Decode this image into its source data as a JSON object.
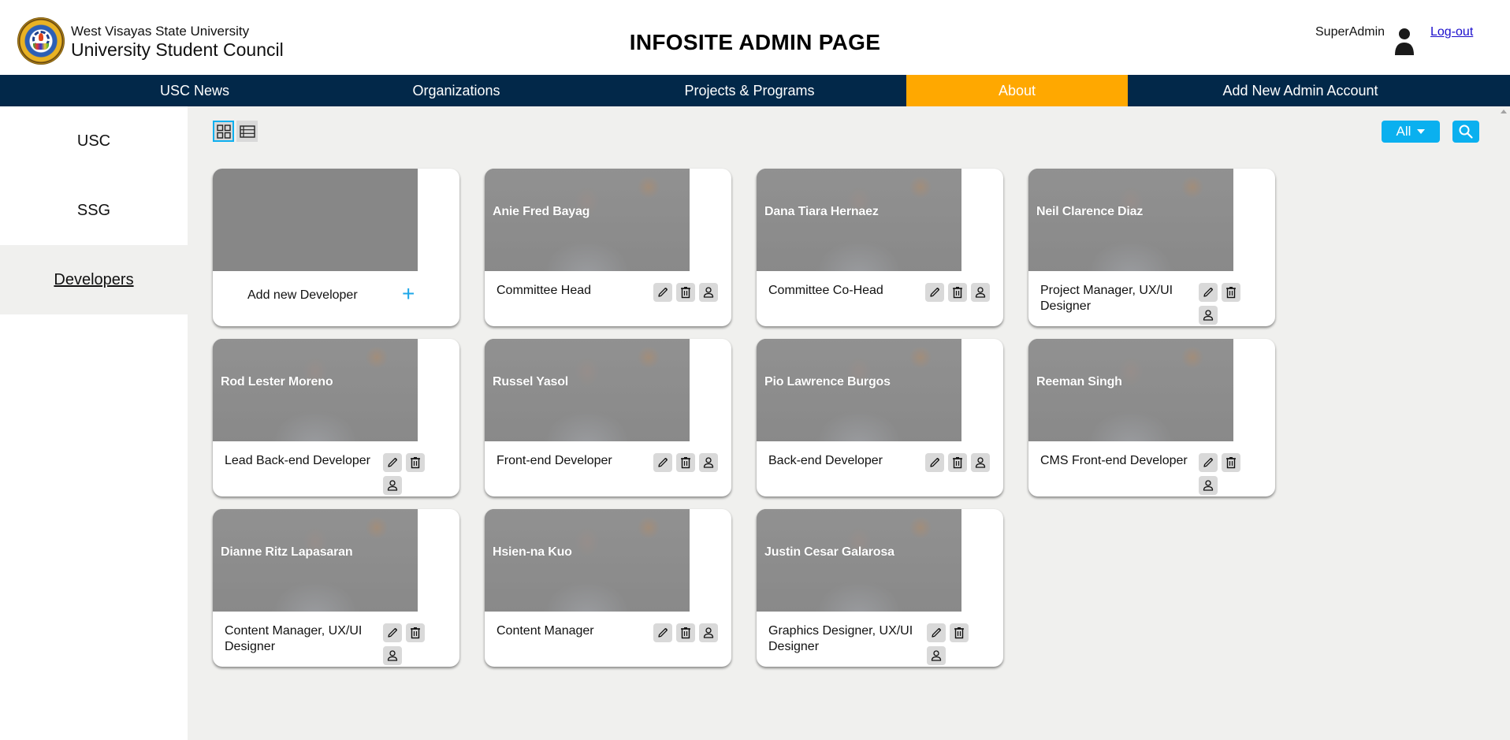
{
  "header": {
    "school": "West Visayas State University",
    "council": "University Student Council",
    "page_title": "INFOSITE ADMIN PAGE",
    "admin_name": "SuperAdmin",
    "logout_label": "Log-out",
    "logo_icon": "usc-seal-logo",
    "user_icon": "user-icon"
  },
  "nav": {
    "items": [
      {
        "label": "USC News",
        "active": false
      },
      {
        "label": "Organizations",
        "active": false
      },
      {
        "label": "Projects & Programs",
        "active": false
      },
      {
        "label": "About",
        "active": true
      },
      {
        "label": "Add New Admin Account",
        "active": false
      }
    ],
    "active_color": "#ffa800",
    "bg_color": "#022849"
  },
  "sidebar": {
    "items": [
      {
        "label": "USC",
        "active": false
      },
      {
        "label": "SSG",
        "active": false
      },
      {
        "label": "Developers",
        "active": true
      }
    ]
  },
  "toolbar": {
    "grid_view_icon": "grid-view-icon",
    "list_view_icon": "list-view-icon",
    "active_view": "grid",
    "filter_value": "All",
    "search_icon": "search-icon",
    "accent_color": "#0ab0ef"
  },
  "add_card": {
    "label": "Add new Developer",
    "plus": "+"
  },
  "developers": [
    {
      "name": "Anie Fred Bayag",
      "role": "Committee Head"
    },
    {
      "name": "Dana Tiara Hernaez",
      "role": "Committee Co-Head"
    },
    {
      "name": "Neil Clarence Diaz",
      "role": "Project Manager, UX/UI Designer"
    },
    {
      "name": "Rod Lester Moreno",
      "role": "Lead Back-end Developer"
    },
    {
      "name": "Russel Yasol",
      "role": "Front-end Developer"
    },
    {
      "name": "Pio Lawrence Burgos",
      "role": "Back-end Developer"
    },
    {
      "name": "Reeman Singh",
      "role": "CMS Front-end Developer"
    },
    {
      "name": "Dianne Ritz Lapasaran",
      "role": "Content Manager, UX/UI Designer"
    },
    {
      "name": "Hsien-na Kuo",
      "role": "Content Manager"
    },
    {
      "name": "Justin Cesar Galarosa",
      "role": "Graphics Designer, UX/UI Designer"
    }
  ],
  "card_actions": [
    "edit",
    "delete",
    "profile"
  ]
}
